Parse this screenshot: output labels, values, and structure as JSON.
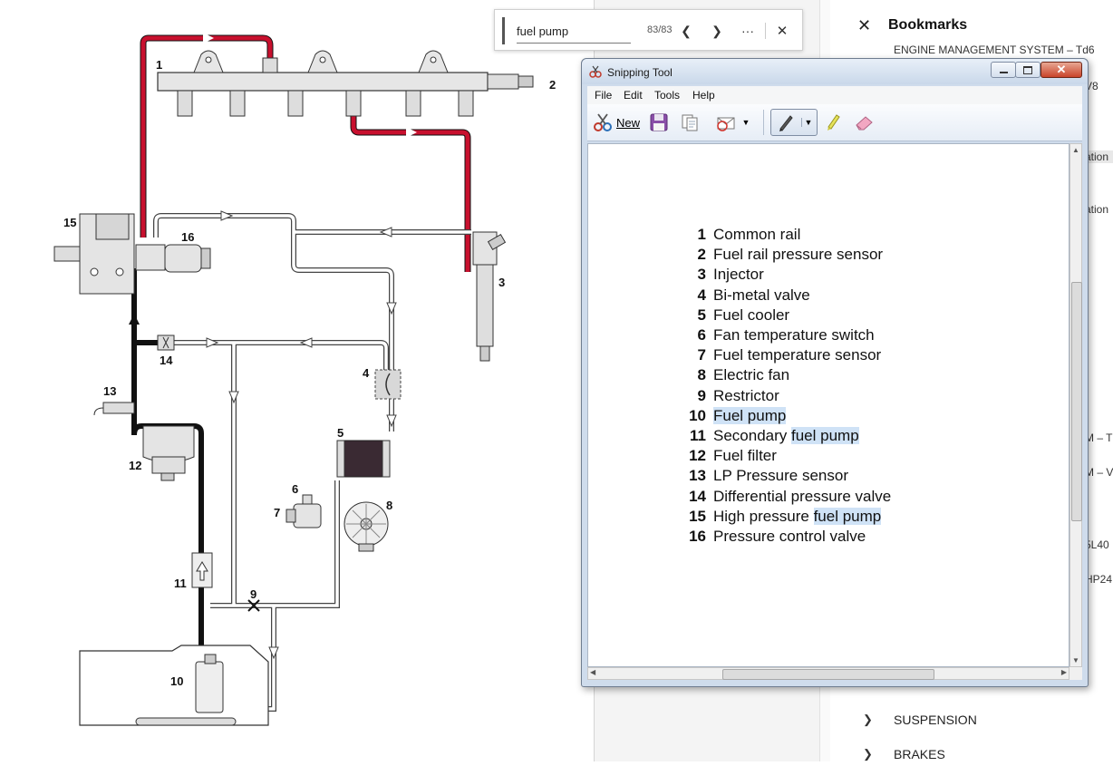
{
  "find_bar": {
    "query": "fuel pump",
    "match_count": "83/83",
    "prev_icon": "chevron-left-icon",
    "next_icon": "chevron-right-icon",
    "more_icon": "more-dots-icon",
    "close_icon": "close-icon"
  },
  "diagram": {
    "labels": [
      "1",
      "2",
      "3",
      "4",
      "5",
      "6",
      "7",
      "8",
      "9",
      "10",
      "11",
      "12",
      "13",
      "14",
      "15",
      "16"
    ],
    "colors": {
      "high_pressure": "#c8102e",
      "supply": "#111111",
      "return": "#ffffff",
      "cooler": "#3a2a33"
    }
  },
  "snipping_tool": {
    "title": "Snipping Tool",
    "menu": [
      "File",
      "Edit",
      "Tools",
      "Help"
    ],
    "toolbar": {
      "new_label": "New"
    },
    "legend": [
      {
        "num": "1",
        "pre": "Common rail",
        "hl": "",
        "post": ""
      },
      {
        "num": "2",
        "pre": "Fuel rail pressure sensor",
        "hl": "",
        "post": ""
      },
      {
        "num": "3",
        "pre": "Injector",
        "hl": "",
        "post": ""
      },
      {
        "num": "4",
        "pre": "Bi-metal valve",
        "hl": "",
        "post": ""
      },
      {
        "num": "5",
        "pre": "Fuel cooler",
        "hl": "",
        "post": ""
      },
      {
        "num": "6",
        "pre": "Fan temperature switch",
        "hl": "",
        "post": ""
      },
      {
        "num": "7",
        "pre": "Fuel temperature sensor",
        "hl": "",
        "post": ""
      },
      {
        "num": "8",
        "pre": "Electric fan",
        "hl": "",
        "post": ""
      },
      {
        "num": "9",
        "pre": "Restrictor",
        "hl": "",
        "post": ""
      },
      {
        "num": "10",
        "pre": "",
        "hl": "Fuel pump",
        "post": ""
      },
      {
        "num": "11",
        "pre": "Secondary ",
        "hl": "fuel pump",
        "post": ""
      },
      {
        "num": "12",
        "pre": "Fuel filter",
        "hl": "",
        "post": ""
      },
      {
        "num": "13",
        "pre": "LP Pressure sensor",
        "hl": "",
        "post": ""
      },
      {
        "num": "14",
        "pre": "Differential pressure valve",
        "hl": "",
        "post": ""
      },
      {
        "num": "15",
        "pre": "High pressure ",
        "hl": "fuel pump",
        "post": ""
      },
      {
        "num": "16",
        "pre": "Pressure control valve",
        "hl": "",
        "post": ""
      }
    ],
    "highlight_color": "#cfe2f6"
  },
  "bookmarks": {
    "title": "Bookmarks",
    "close_icon": "close-icon",
    "truncated_top": "ENGINE MANAGEMENT SYSTEM – Td6",
    "edge_fragments": [
      "V8",
      "ation",
      "ation",
      "M – T",
      "M – V",
      "5L40",
      "HP24"
    ],
    "items": [
      {
        "label": "SUSPENSION"
      },
      {
        "label": "BRAKES"
      }
    ]
  }
}
